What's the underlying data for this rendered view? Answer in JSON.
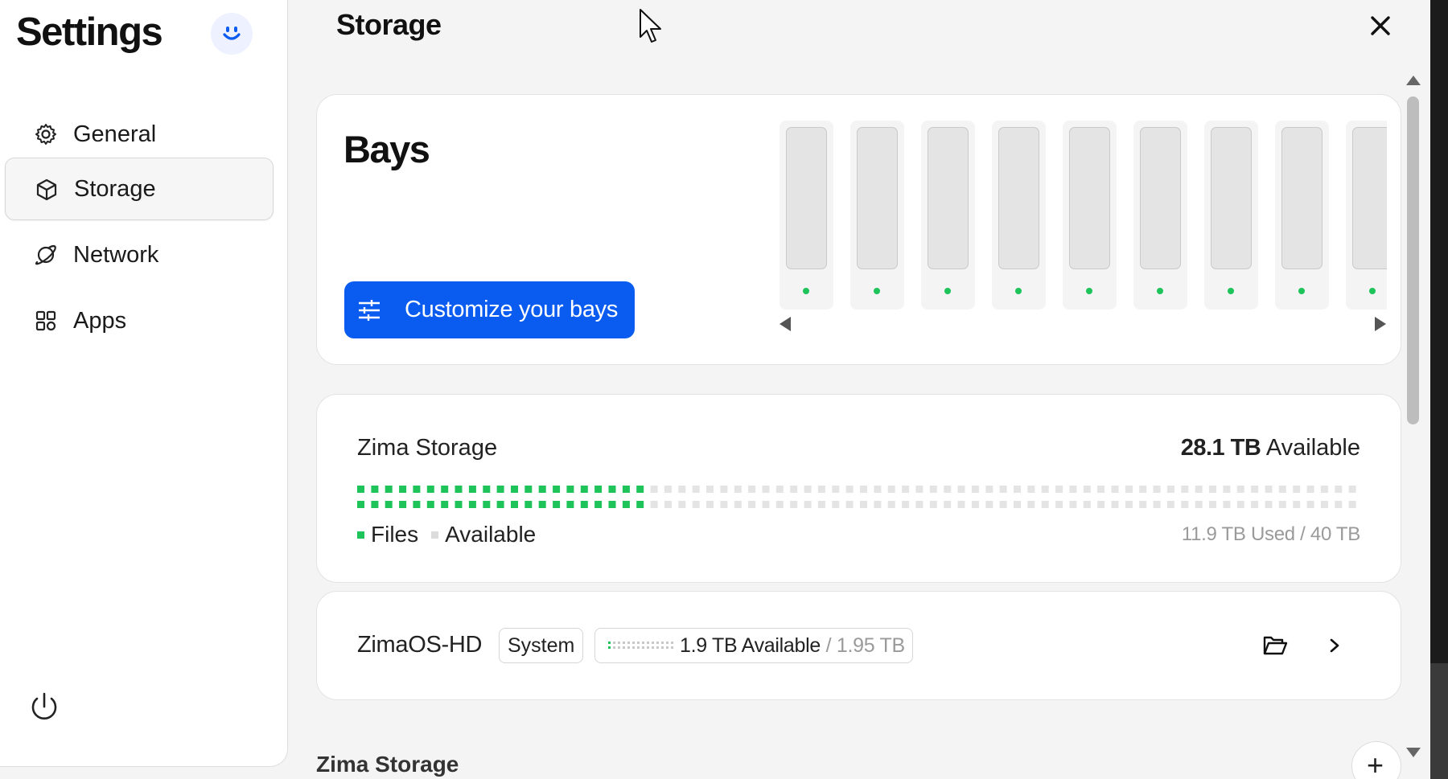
{
  "sidebar": {
    "title": "Settings",
    "avatar_icon": "smiley-icon",
    "items": [
      {
        "label": "General",
        "icon": "gear-icon",
        "active": false
      },
      {
        "label": "Storage",
        "icon": "cube-icon",
        "active": true
      },
      {
        "label": "Network",
        "icon": "planet-icon",
        "active": false
      },
      {
        "label": "Apps",
        "icon": "grid-icon",
        "active": false
      }
    ],
    "power_icon": "power-icon"
  },
  "header": {
    "title": "Storage",
    "close_icon": "close-icon"
  },
  "bays": {
    "title": "Bays",
    "customize_label": "Customize your bays",
    "bay_count": 9,
    "status_color": "#1ec35a"
  },
  "zima_storage": {
    "name": "Zima Storage",
    "available_value": "28.1 TB",
    "available_label": "Available",
    "used_fraction": 0.297,
    "legend": [
      {
        "label": "Files",
        "color": "#1ec35a"
      },
      {
        "label": "Available",
        "color": "#dcdcdc"
      }
    ],
    "usage_text": "11.9 TB Used / 40 TB"
  },
  "disk": {
    "name": "ZimaOS-HD",
    "badge": "System",
    "available": "1.9 TB Available",
    "total": " / 1.95 TB",
    "folder_icon": "folder-open-icon",
    "chevron_icon": "chevron-right-icon"
  },
  "section": {
    "label": "Zima Storage",
    "add_label": "+"
  },
  "colors": {
    "accent": "#0a5cf0",
    "green": "#1ec35a"
  }
}
